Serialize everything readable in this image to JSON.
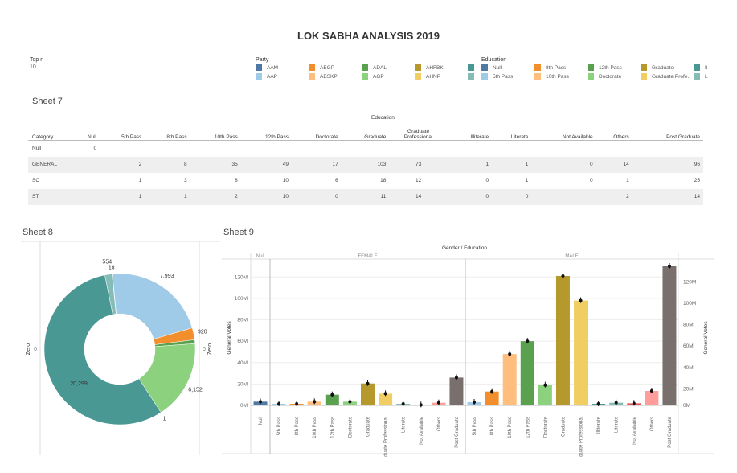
{
  "title": "LOK SABHA ANALYSIS 2019",
  "filter": {
    "label": "Top n",
    "value": "10"
  },
  "party_legend": {
    "title": "Party",
    "items": [
      {
        "label": "AAM",
        "color": "#4e79a7"
      },
      {
        "label": "AAP",
        "color": "#a0cbe8"
      },
      {
        "label": "ABGP",
        "color": "#f28e2b"
      },
      {
        "label": "ABSKP",
        "color": "#ffbe7d"
      },
      {
        "label": "ADAL",
        "color": "#59a14f"
      },
      {
        "label": "AGP",
        "color": "#8cd17d"
      },
      {
        "label": "AHFBK",
        "color": "#b6992d"
      },
      {
        "label": "AHNP",
        "color": "#f1ce63"
      },
      {
        "label": "",
        "color": "#499894"
      },
      {
        "label": "",
        "color": "#86bcb6"
      }
    ]
  },
  "education_legend": {
    "title": "Education",
    "items": [
      {
        "label": "Null",
        "color": "#4e79a7"
      },
      {
        "label": "5th Pass",
        "color": "#a0cbe8"
      },
      {
        "label": "8th Pass",
        "color": "#f28e2b"
      },
      {
        "label": "10th Pass",
        "color": "#ffbe7d"
      },
      {
        "label": "12th Pass",
        "color": "#59a14f"
      },
      {
        "label": "Doctorate",
        "color": "#8cd17d"
      },
      {
        "label": "Graduate",
        "color": "#b6992d"
      },
      {
        "label": "Graduate Profe..",
        "color": "#f1ce63"
      },
      {
        "label": "Il",
        "color": "#499894"
      },
      {
        "label": "L",
        "color": "#86bcb6"
      }
    ]
  },
  "sheet7": {
    "title": "Sheet 7",
    "group_header": "Education",
    "row_header": "Category",
    "columns": [
      "Null",
      "5th Pass",
      "8th Pass",
      "10th Pass",
      "12th Pass",
      "Doctorate",
      "Graduate",
      "Graduate Professional",
      "Illiterate",
      "Literate",
      "Not Available",
      "Others",
      "Post Graduate"
    ],
    "rows": [
      {
        "category": "Null",
        "values": [
          "0",
          "",
          "",
          "",
          "",
          "",
          "",
          "",
          "",
          "",
          "",
          "",
          ""
        ]
      },
      {
        "category": "GENERAL",
        "values": [
          "",
          "2",
          "8",
          "35",
          "49",
          "17",
          "103",
          "73",
          "1",
          "1",
          "0",
          "14",
          "96"
        ]
      },
      {
        "category": "SC",
        "values": [
          "",
          "1",
          "3",
          "8",
          "10",
          "6",
          "18",
          "12",
          "0",
          "1",
          "0",
          "1",
          "25"
        ]
      },
      {
        "category": "ST",
        "values": [
          "",
          "1",
          "1",
          "2",
          "10",
          "0",
          "11",
          "14",
          "0",
          "0",
          "",
          "2",
          "14"
        ]
      }
    ]
  },
  "sheet8": {
    "title": "Sheet 8",
    "left_axis": "Zero",
    "right_axis": "Zero",
    "left_tick": "0",
    "right_tick": "0"
  },
  "sheet9": {
    "title": "Sheet 9",
    "header": "Gender / Education",
    "panels": [
      "Null",
      "FEMALE",
      "MALE"
    ],
    "ylabel": "General Votes",
    "yticks": [
      "0M",
      "20M",
      "40M",
      "60M",
      "80M",
      "100M",
      "120M"
    ]
  },
  "chart_data": [
    {
      "type": "pie",
      "title": "",
      "slices": [
        {
          "value": 7993,
          "label": "7,993",
          "color": "#a0cbe8"
        },
        {
          "value": 920,
          "label": "920",
          "color": "#f28e2b"
        },
        {
          "value": 0,
          "label": "",
          "color": "#ffbe7d"
        },
        {
          "value": 300,
          "label": "",
          "color": "#59a14f"
        },
        {
          "value": 6152,
          "label": "6,152",
          "color": "#8cd17d"
        },
        {
          "value": 1,
          "label": "1",
          "color": "#b6992d"
        },
        {
          "value": 20299,
          "label": "20,299",
          "color": "#499894"
        },
        {
          "value": 554,
          "label": "554",
          "color": "#86bcb6"
        },
        {
          "value": 18,
          "label": "18",
          "color": "#e15759"
        }
      ]
    },
    {
      "type": "bar",
      "title": "",
      "xlabel": "",
      "ylabel": "General Votes",
      "ylim": [
        0,
        130
      ],
      "unit": "M",
      "panels": [
        {
          "name": "Null",
          "categories": [
            "Null"
          ],
          "values": [
            3.5
          ],
          "colors": [
            "#4e79a7"
          ]
        },
        {
          "name": "FEMALE",
          "categories": [
            "5th Pass",
            "8th Pass",
            "10th Pass",
            "12th Pass",
            "Doctorate",
            "Graduate",
            "Graduate Professional",
            "Literate",
            "Not Available",
            "Others",
            "Post Graduate"
          ],
          "values": [
            1.5,
            1.5,
            3.5,
            10,
            3.5,
            20.5,
            11,
            1.5,
            0.5,
            2.5,
            26
          ],
          "colors": [
            "#a0cbe8",
            "#f28e2b",
            "#ffbe7d",
            "#59a14f",
            "#8cd17d",
            "#b6992d",
            "#f1ce63",
            "#86bcb6",
            "#e15759",
            "#ff9d9a",
            "#79706e"
          ]
        },
        {
          "name": "MALE",
          "categories": [
            "5th Pass",
            "8th Pass",
            "10th Pass",
            "12th Pass",
            "Doctorate",
            "Graduate",
            "Graduate Professional",
            "Illiterate",
            "Literate",
            "Not Available",
            "Others",
            "Post Graduate"
          ],
          "values": [
            3,
            13,
            48,
            60,
            19,
            121,
            98,
            1.5,
            2.5,
            2,
            13.5,
            130
          ],
          "colors": [
            "#a0cbe8",
            "#f28e2b",
            "#ffbe7d",
            "#59a14f",
            "#8cd17d",
            "#b6992d",
            "#f1ce63",
            "#499894",
            "#86bcb6",
            "#e15759",
            "#ff9d9a",
            "#79706e"
          ]
        }
      ]
    }
  ]
}
